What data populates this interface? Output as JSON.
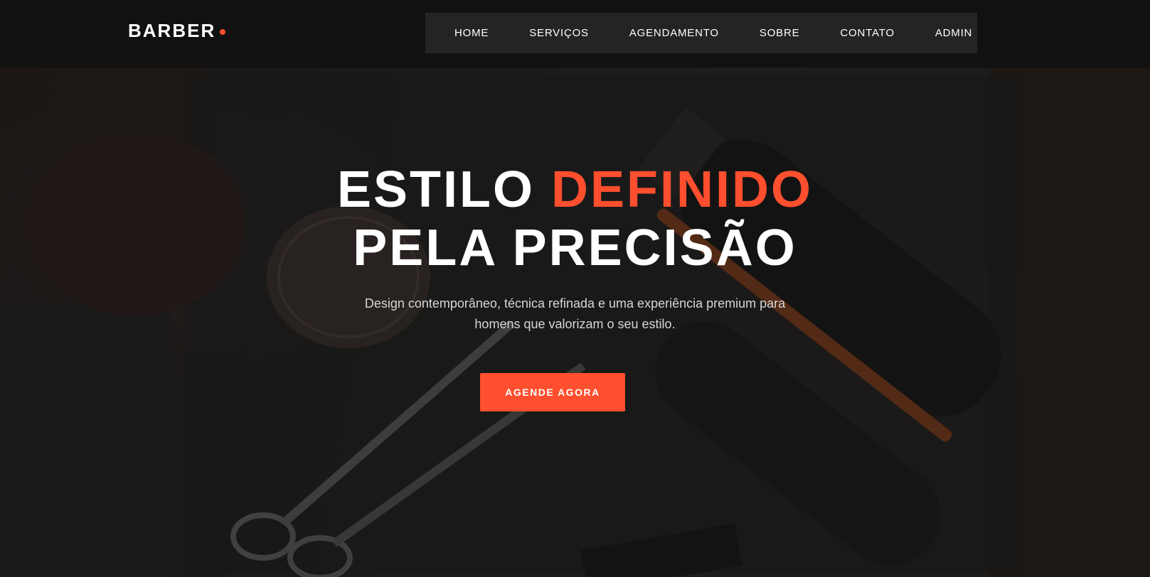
{
  "header": {
    "logo_text": "BARBER",
    "logo_dot_color": "#ff4f2e",
    "nav": [
      {
        "label": "HOME"
      },
      {
        "label": "SERVIÇOS"
      },
      {
        "label": "AGENDAMENTO"
      },
      {
        "label": "SOBRE"
      },
      {
        "label": "CONTATO"
      },
      {
        "label": "ADMIN"
      }
    ]
  },
  "hero": {
    "headline_line1_a": "ESTILO",
    "headline_line1_b": "DEFINIDO",
    "headline_line2": "PELA PRECISÃO",
    "subtitle_line1": "Design contemporâneo, técnica refinada e uma experiência premium para",
    "subtitle_line2": "homens que valorizam o seu estilo.",
    "cta_label": "AGENDE AGORA",
    "accent_color": "#ff4f2e"
  }
}
